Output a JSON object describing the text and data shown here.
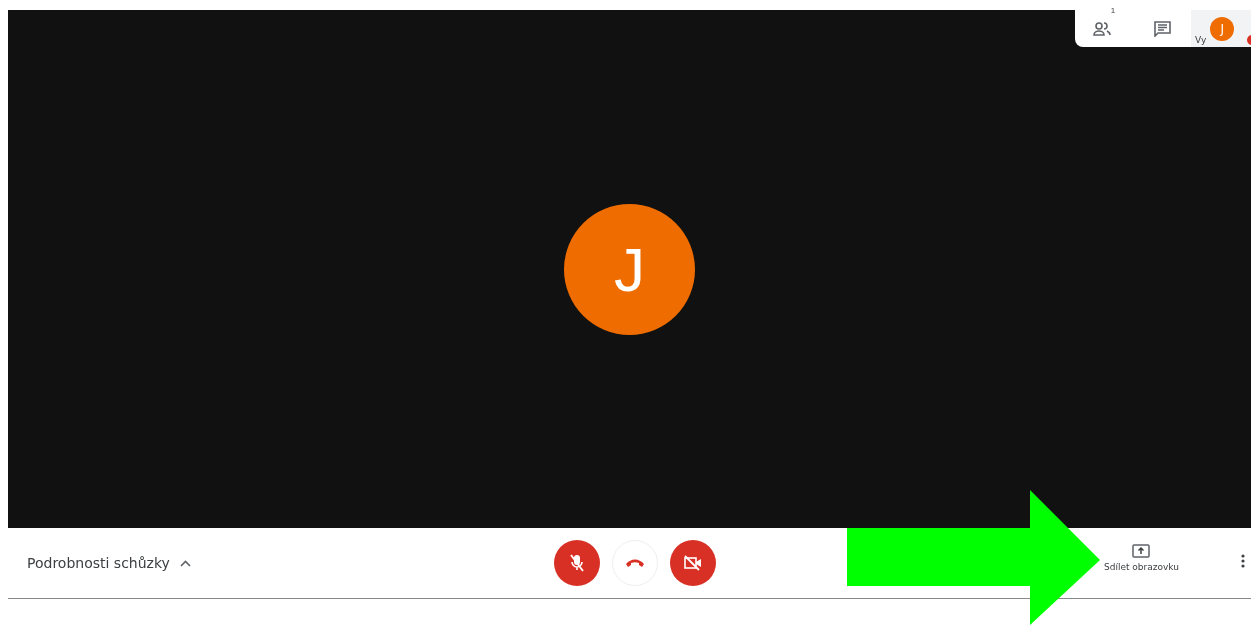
{
  "top_panel": {
    "participants_count": "1",
    "self_label": "Vy",
    "self_initial": "J",
    "self_alert": true
  },
  "video": {
    "initial": "J"
  },
  "bottom_bar": {
    "details_label": "Podrobnosti schůzky",
    "details_expanded": false,
    "controls": [
      {
        "kind": "mic",
        "off": true
      },
      {
        "kind": "hangup",
        "off": false
      },
      {
        "kind": "camera",
        "off": true
      }
    ],
    "share_label": "Sdílet obrazovku"
  },
  "annotation": {
    "kind": "arrow",
    "color": "#00ff00"
  }
}
